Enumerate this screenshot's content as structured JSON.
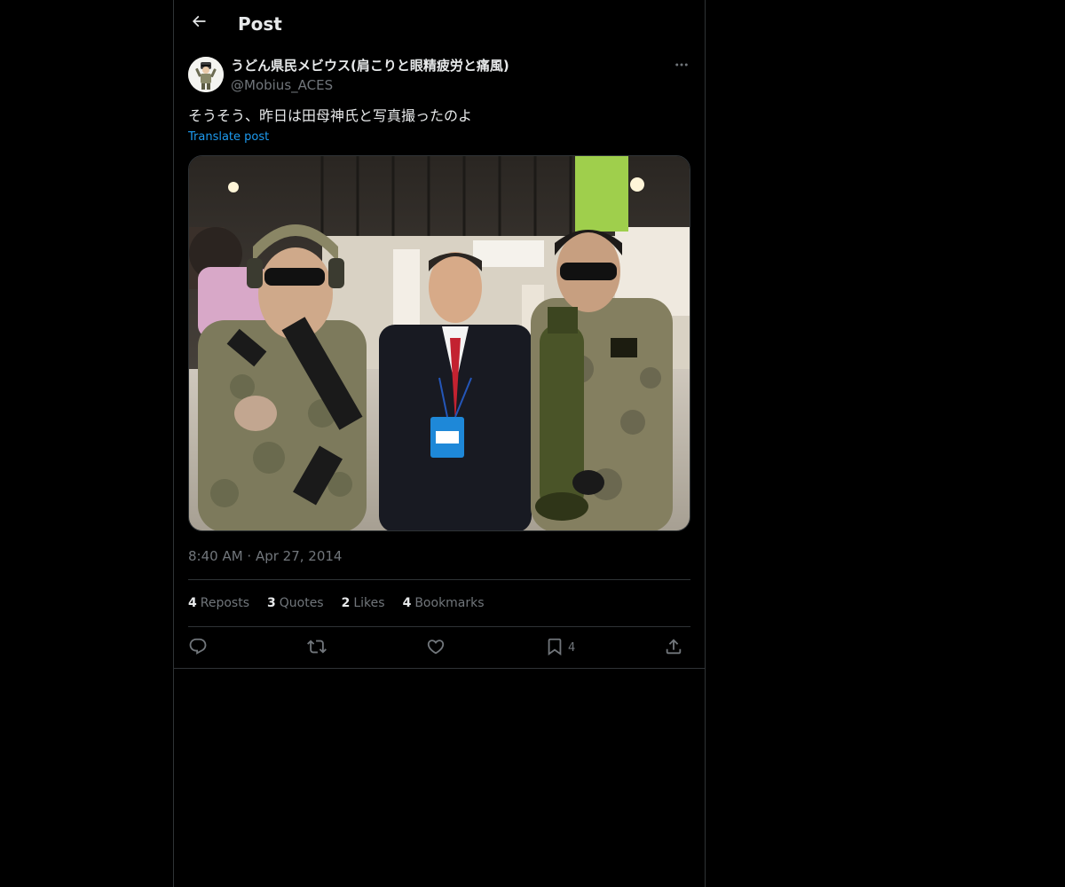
{
  "header": {
    "back_icon": "arrow-left-icon",
    "title": "Post"
  },
  "author": {
    "display_name": "うどん県民メビウス(肩こりと眼精疲労と痛風)",
    "handle": "@Mobius_ACES",
    "avatar_icon": "avatar-cartoon-soldier"
  },
  "tweet": {
    "text": "そうそう、昨日は田母神氏と写真撮ったのよ",
    "translate_label": "Translate post",
    "media_alt": "photo",
    "timestamp": "8:40 AM · Apr 27, 2014"
  },
  "stats": [
    {
      "count": "4",
      "label": "Reposts"
    },
    {
      "count": "3",
      "label": "Quotes"
    },
    {
      "count": "2",
      "label": "Likes"
    },
    {
      "count": "4",
      "label": "Bookmarks"
    }
  ],
  "actions": {
    "reply_icon": "reply-icon",
    "repost_icon": "repost-icon",
    "like_icon": "heart-icon",
    "bookmark_icon": "bookmark-icon",
    "bookmark_count": "4",
    "share_icon": "share-icon"
  },
  "colors": {
    "background": "#000000",
    "text_primary": "#e7e9ea",
    "text_secondary": "#71767b",
    "accent": "#1d9bf0",
    "border": "#2f3336"
  }
}
